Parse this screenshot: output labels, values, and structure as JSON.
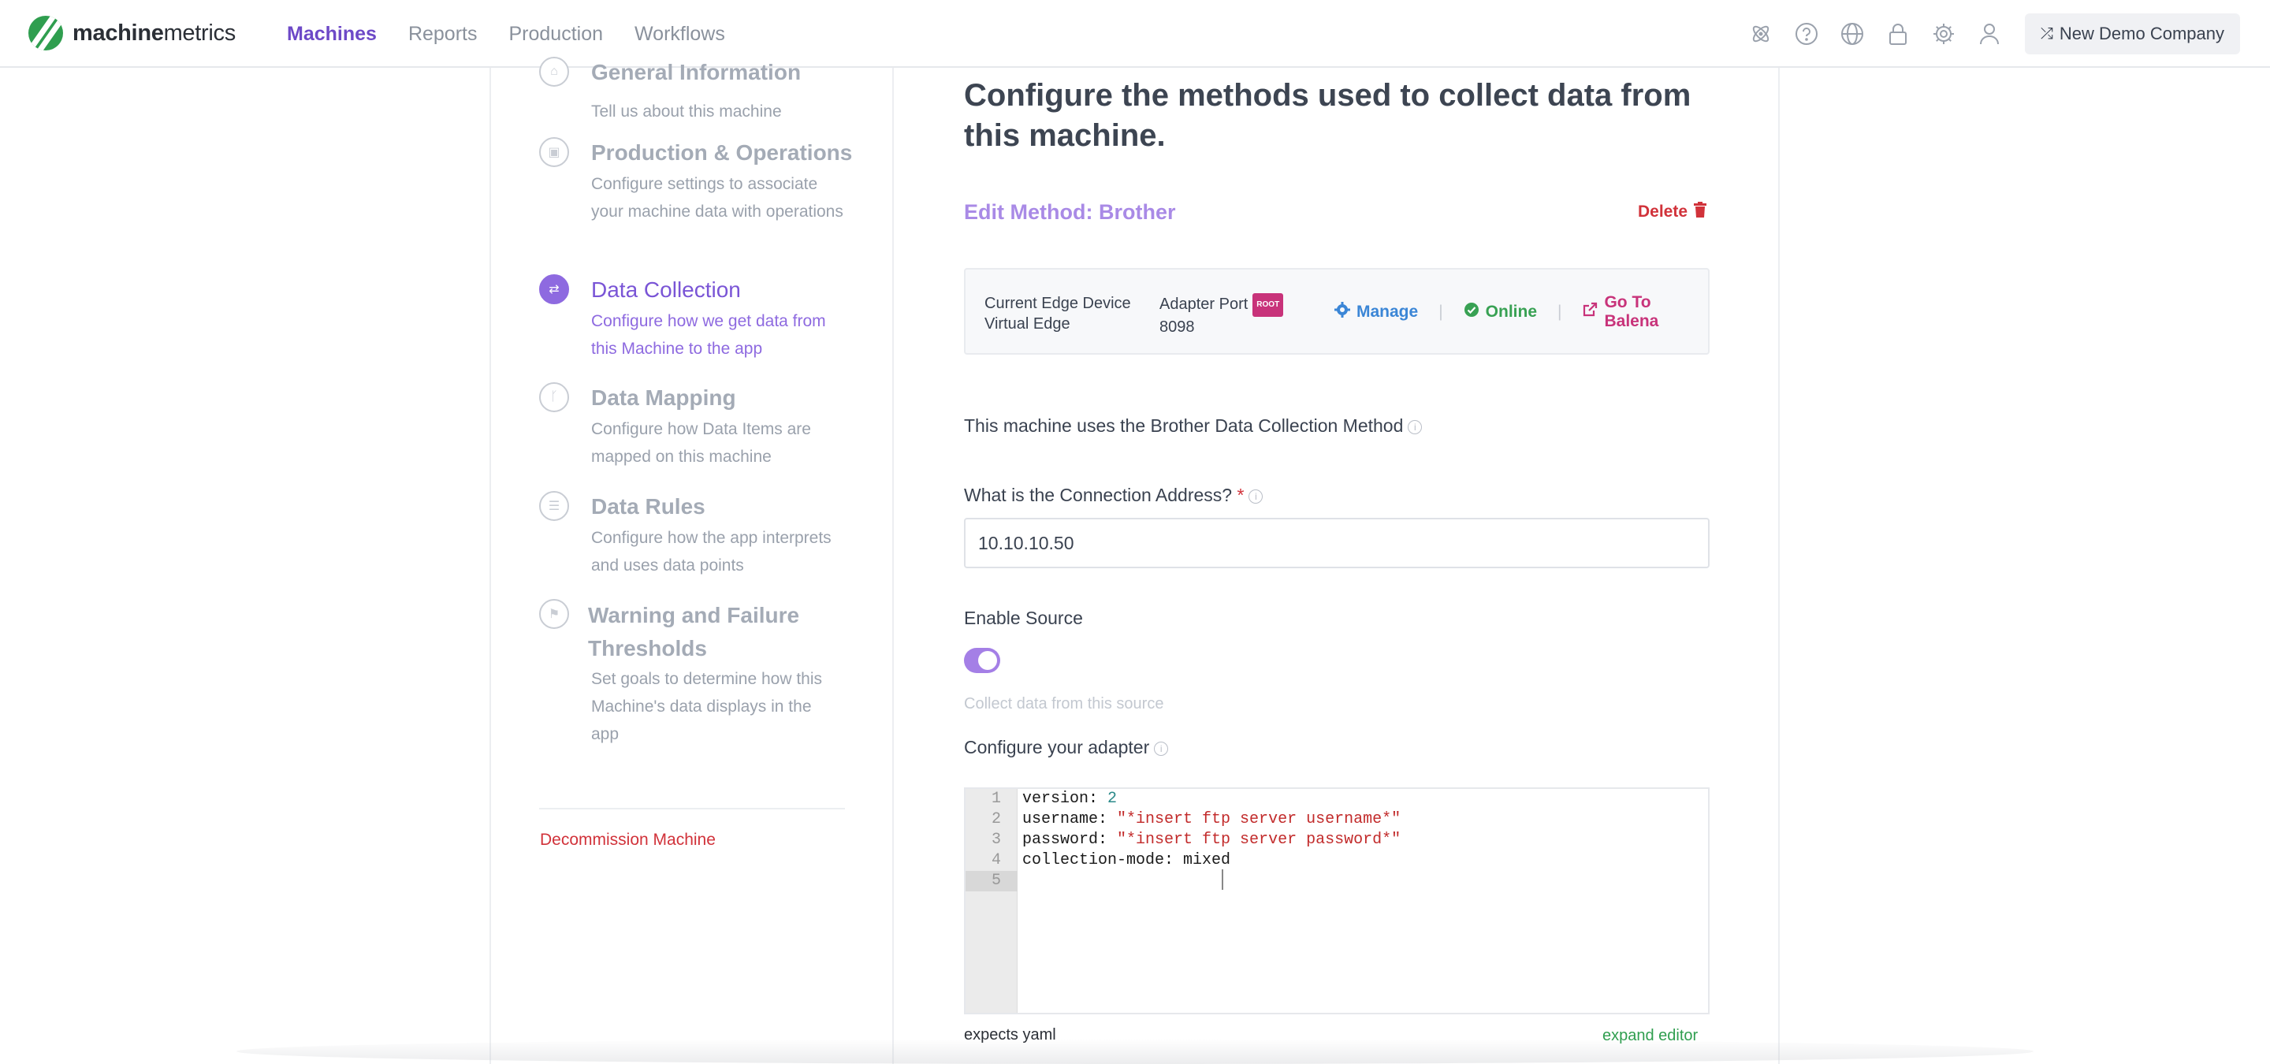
{
  "app": {
    "logo_bold": "machine",
    "logo_light": "metrics"
  },
  "nav": {
    "items": [
      {
        "label": "Machines",
        "active": true
      },
      {
        "label": "Reports",
        "active": false
      },
      {
        "label": "Production",
        "active": false
      },
      {
        "label": "Workflows",
        "active": false
      }
    ]
  },
  "top_icons": [
    "atom-icon",
    "help-circle-icon",
    "globe-icon",
    "lock-icon",
    "gear-icon",
    "user-icon"
  ],
  "company": {
    "label": "New Demo Company",
    "icon": "shuffle-icon"
  },
  "sidebar": {
    "steps": [
      {
        "title": "General Information",
        "desc": "Tell us about this machine",
        "icon": "home-icon",
        "active": false
      },
      {
        "title": "Production & Operations",
        "desc": "Configure settings to associate your machine data with operations",
        "icon": "box-icon",
        "active": false
      },
      {
        "title": "Data Collection",
        "desc": "Configure how we get data from this Machine to the app",
        "icon": "exchange-icon",
        "active": true
      },
      {
        "title": "Data Mapping",
        "desc": "Configure how Data Items are mapped on this machine",
        "icon": "branch-icon",
        "active": false
      },
      {
        "title": "Data Rules",
        "desc": "Configure how the app interprets and uses data points",
        "icon": "list-icon",
        "active": false
      },
      {
        "title": "Warning and Failure Thresholds",
        "desc": "Set goals to determine how this Machine's data displays in the app",
        "icon": "flag-icon",
        "active": false
      }
    ],
    "decommission": "Decommission Machine"
  },
  "main": {
    "title": "Configure the methods used to collect data from this machine.",
    "edit_method": "Edit Method: Brother",
    "delete_label": "Delete",
    "device": {
      "edge_label": "Current Edge Device",
      "edge_value": "Virtual Edge",
      "port_label": "Adapter Port",
      "port_badge": "ROOT",
      "port_value": "8098",
      "manage_label": "Manage",
      "status_label": "Online",
      "balena_label": "Go To Balena"
    },
    "uses_method": "This machine uses the Brother Data Collection Method",
    "address": {
      "label": "What is the Connection Address?",
      "required": "*",
      "value": "10.10.10.50"
    },
    "enable_source": {
      "label": "Enable Source",
      "enabled": true,
      "hint": "Collect data from this source"
    },
    "adapter": {
      "label": "Configure your adapter",
      "line_numbers": [
        "1",
        "2",
        "3",
        "4",
        "5"
      ],
      "lines": [
        {
          "key": "version: ",
          "value": "2",
          "type": "num"
        },
        {
          "key": "username: ",
          "value": "\"*insert ftp server username*\"",
          "type": "str"
        },
        {
          "key": "password: ",
          "value": "\"*insert ftp server password*\"",
          "type": "str"
        },
        {
          "key": "collection-mode: ",
          "value": "mixed",
          "type": "plain"
        },
        {
          "key": "",
          "value": "",
          "type": "plain"
        }
      ],
      "format_hint": "expects yaml",
      "expand_label": "expand editor"
    }
  }
}
